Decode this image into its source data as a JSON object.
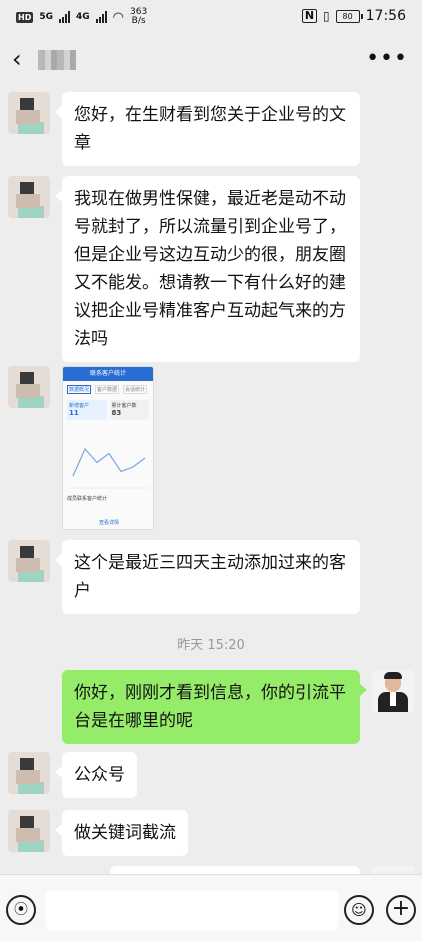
{
  "status_bar": {
    "hd_label": "HD",
    "signal_1": "5G",
    "signal_2": "4G",
    "net_speed_value": "363",
    "net_speed_unit": "B/s",
    "nfc_label": "N",
    "battery_level": "80",
    "time": "17:56"
  },
  "nav": {
    "back_icon": "chevron-left-icon",
    "more_icon": "ellipsis-icon",
    "title_obscured": true
  },
  "messages": [
    {
      "side": "left",
      "text": "您好，在生财看到您关于企业号的文章"
    },
    {
      "side": "left",
      "text": "我现在做男性保健，最近老是动不动号就封了，所以流量引到企业号了，但是企业号这边互动少的很，朋友圈又不能发。想请教一下有什么好的建议把企业号精准客户互动起气来的方法吗"
    },
    {
      "side": "left",
      "type": "image"
    },
    {
      "side": "left",
      "text": "这个是最近三四天主动添加过来的客户"
    },
    {
      "side": "right",
      "text": "你好，刚刚才看到信息，你的引流平台是在哪里的呢"
    },
    {
      "side": "left",
      "text": "公众号"
    },
    {
      "side": "left",
      "text": "做关键词截流"
    }
  ],
  "timestamp": "昨天 15:20",
  "thumbnail": {
    "header": "联系客户统计",
    "tabs": [
      "数据概况",
      "客户数据",
      "会话统计"
    ],
    "card1_label": "新增客户",
    "card1_value": "11",
    "card2_label": "累计客户数",
    "card2_value": "83",
    "footer": "成员联系客户统计",
    "button": "查看详情",
    "chart_data": {
      "type": "line",
      "values": [
        10,
        40,
        25,
        35,
        15,
        20,
        30
      ]
    }
  },
  "bottom_bar": {
    "voice_icon": "voice-icon",
    "emoji_icon": "emoji-icon",
    "plus_icon": "plus-icon",
    "input_value": ""
  }
}
